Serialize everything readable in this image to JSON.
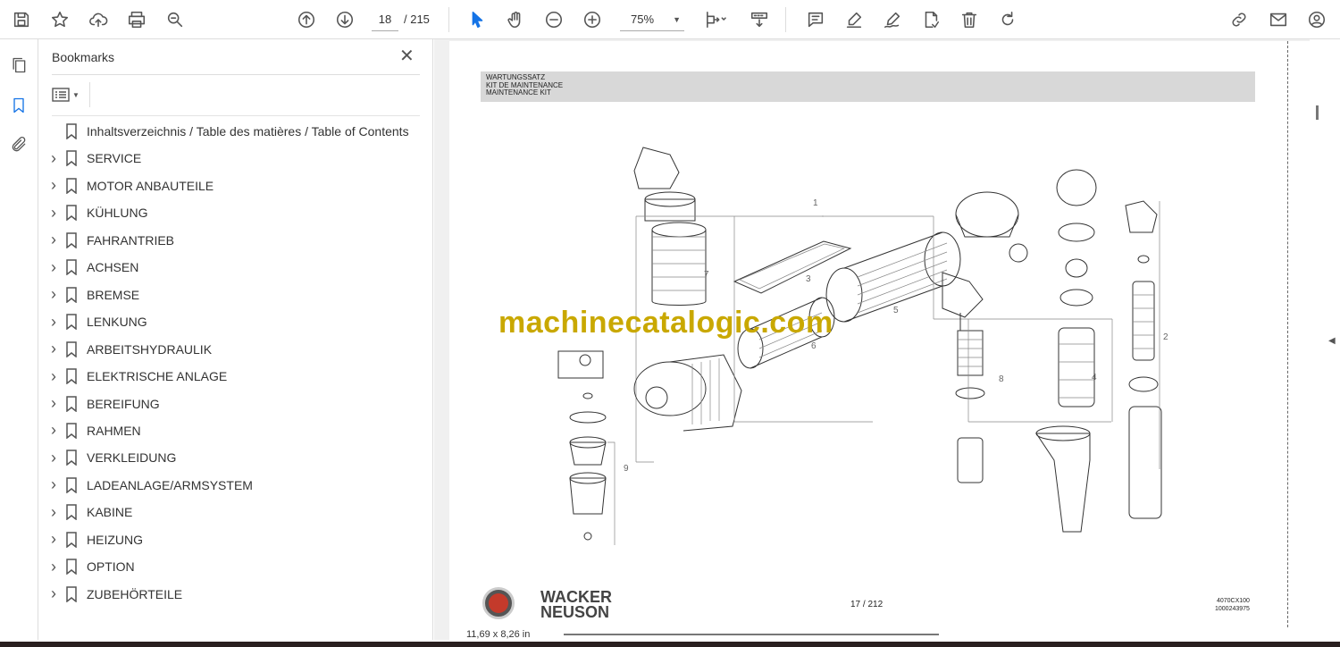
{
  "toolbar": {
    "current_page": "18",
    "total_pages": "/ 215",
    "zoom": "75%"
  },
  "bookmarks_panel": {
    "title": "Bookmarks",
    "items": [
      {
        "label": "Inhaltsverzeichnis / Table des matières / Table of Contents",
        "expandable": false
      },
      {
        "label": "SERVICE",
        "expandable": true
      },
      {
        "label": "MOTOR ANBAUTEILE",
        "expandable": true
      },
      {
        "label": "KÜHLUNG",
        "expandable": true
      },
      {
        "label": "FAHRANTRIEB",
        "expandable": true
      },
      {
        "label": "ACHSEN",
        "expandable": true
      },
      {
        "label": "BREMSE",
        "expandable": true
      },
      {
        "label": "LENKUNG",
        "expandable": true
      },
      {
        "label": "ARBEITSHYDRAULIK",
        "expandable": true
      },
      {
        "label": "ELEKTRISCHE ANLAGE",
        "expandable": true
      },
      {
        "label": "BEREIFUNG",
        "expandable": true
      },
      {
        "label": "RAHMEN",
        "expandable": true
      },
      {
        "label": "VERKLEIDUNG",
        "expandable": true
      },
      {
        "label": "LADEANLAGE/ARMSYSTEM",
        "expandable": true
      },
      {
        "label": "KABINE",
        "expandable": true
      },
      {
        "label": "HEIZUNG",
        "expandable": true
      },
      {
        "label": "OPTION",
        "expandable": true
      },
      {
        "label": "ZUBEHÖRTEILE",
        "expandable": true
      }
    ]
  },
  "document": {
    "header_lines": [
      "WARTUNGSSATZ",
      "KIT DE MAINTENANCE",
      "MAINTENANCE KIT"
    ],
    "watermark": "machinecatalogic.com",
    "brand_line1": "WACKER",
    "brand_line2": "NEUSON",
    "page_label": "17 / 212",
    "doc_number_1": "4070CX100",
    "doc_number_2": "1000243975",
    "callouts": [
      "1",
      "2",
      "3",
      "4",
      "5",
      "6",
      "7",
      "8",
      "9"
    ]
  },
  "status_bar": {
    "page_size": "11,69 x 8,26 in"
  },
  "colors": {
    "accent": "#1473e6",
    "watermark": "#c9a800",
    "header_band": "#d8d8d8"
  }
}
